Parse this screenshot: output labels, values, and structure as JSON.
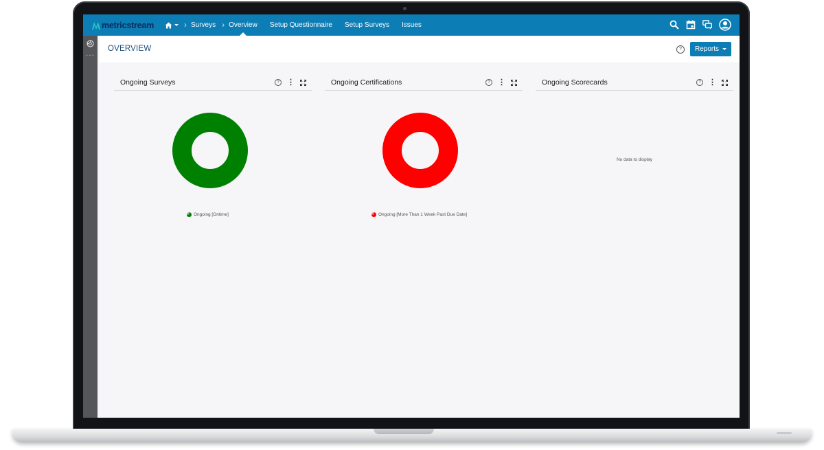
{
  "app": {
    "brand": "metricstream",
    "brand_color": "#0c7db5"
  },
  "nav": {
    "home_icon": "home-icon",
    "items": [
      {
        "label": "Surveys",
        "active": false
      },
      {
        "label": "Overview",
        "active": true
      },
      {
        "label": "Setup Questionnaire",
        "active": false
      },
      {
        "label": "Setup Surveys",
        "active": false
      },
      {
        "label": "Issues",
        "active": false
      }
    ]
  },
  "topbar_icons": [
    "search-icon",
    "calendar-icon",
    "chat-icon",
    "user-avatar-icon"
  ],
  "header": {
    "title": "OVERVIEW",
    "help": "?",
    "reports_label": "Reports"
  },
  "widgets": [
    {
      "title": "Ongoing Surveys",
      "help": "?",
      "kebab": "⋮",
      "chart_color": "#008000",
      "legend": "Ongoing [Ontime]"
    },
    {
      "title": "Ongoing Certifications",
      "help": "?",
      "kebab": "⋮",
      "chart_color": "#ff0000",
      "legend": "Ongoing [More Than 1 Week Past Due Date]"
    },
    {
      "title": "Ongoing Scorecards",
      "help": "?",
      "kebab": "⋮",
      "empty_text": "No data to display"
    }
  ],
  "siderail": {
    "more": "···"
  }
}
